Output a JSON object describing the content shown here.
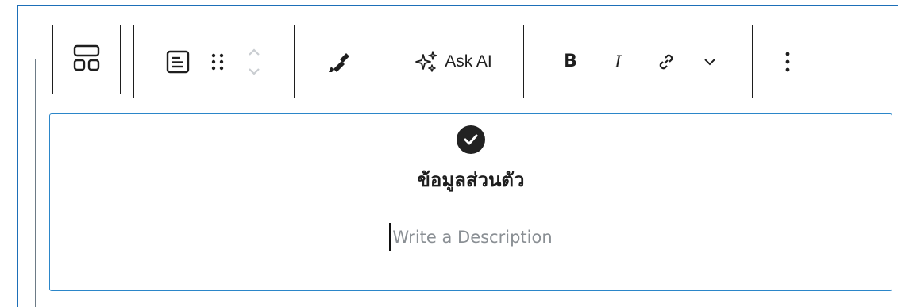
{
  "toolbar": {
    "ask_ai_label": "Ask AI",
    "bold_label": "B",
    "italic_label": "I",
    "icons": [
      "block-layout-icon",
      "paragraph-card-icon",
      "drag-handle-icon",
      "move-up-down-icon",
      "highlighter-icon",
      "ai-sparkle-icon",
      "link-icon",
      "chevron-down-icon",
      "more-options-icon"
    ]
  },
  "block": {
    "title": "ข้อมูลส่วนตัว",
    "description_placeholder": "Write a Description"
  },
  "colors": {
    "frame_accent": "#1d6fb8",
    "block_border": "#2b86c9",
    "check_bg": "#222222",
    "placeholder_text": "#8a8f94"
  }
}
